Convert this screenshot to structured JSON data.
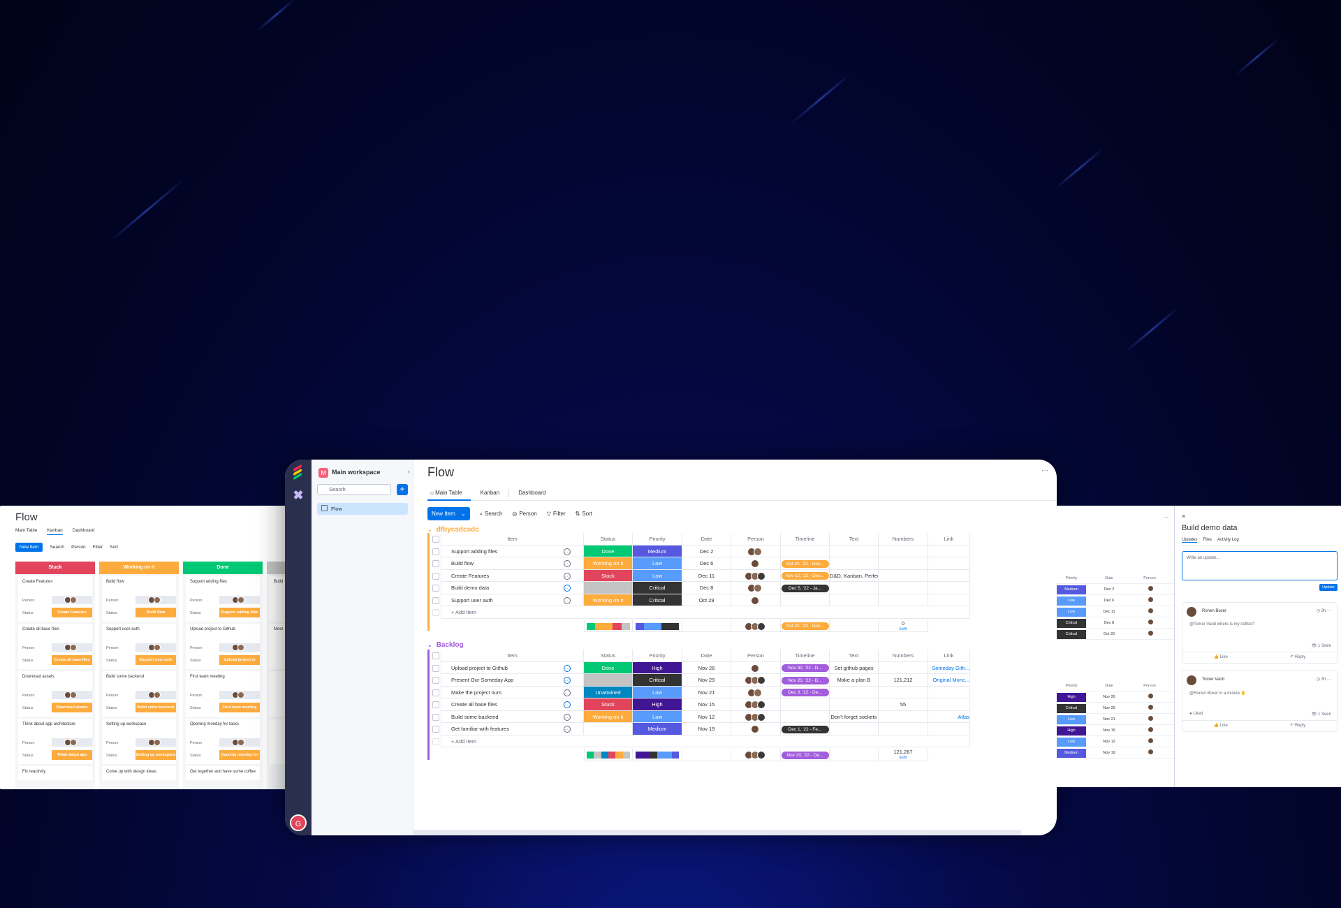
{
  "colors": {
    "blue": "#0073ea",
    "done": "#00c875",
    "working": "#fdab3d",
    "stuck": "#e2445c",
    "gray": "#c4c4c4",
    "medium": "#5559df",
    "low": "#579bfc",
    "critical": "#333333",
    "high": "#401694",
    "unattained": "#0086c0",
    "timeline_orange": "#fdab3d",
    "timeline_purple": "#a25ddc",
    "timeline_dark": "#333333"
  },
  "left": {
    "title": "Flow",
    "tabs": [
      "Main Table",
      "Kanban",
      "Dashboard"
    ],
    "tools": {
      "new_item": "New Item",
      "search": "Search",
      "person": "Person",
      "filter": "Filter",
      "sort": "Sort"
    },
    "columns": [
      {
        "name": "Stuck",
        "color": "#e2445c",
        "cards": [
          {
            "title": "Create Features",
            "status": "Create Features"
          },
          {
            "title": "Create all base files",
            "status": "Create all base files"
          },
          {
            "title": "Download assets",
            "status": "Download assets"
          },
          {
            "title": "Think about app architecture",
            "status": "Think about app architecture"
          }
        ],
        "last": "Fix reactivity"
      },
      {
        "name": "Working on it",
        "color": "#fdab3d",
        "cards": [
          {
            "title": "Build flow",
            "status": "Build flow"
          },
          {
            "title": "Support user auth",
            "status": "Support user auth"
          },
          {
            "title": "Build some backend",
            "status": "Build some backend"
          },
          {
            "title": "Setting up workspace",
            "status": "Setting up workspace"
          }
        ],
        "last": "Come up with design ideas"
      },
      {
        "name": "Done",
        "color": "#00c875",
        "cards": [
          {
            "title": "Support adding files",
            "status": "Support adding files"
          },
          {
            "title": "Upload project to Github",
            "status": "Upload project to Github"
          },
          {
            "title": "First team meeting",
            "status": "First team meeting"
          },
          {
            "title": "Opening monday for tasks",
            "status": "Opening monday for tasks"
          }
        ],
        "last": "Get together and have some coffee"
      },
      {
        "name": "",
        "color": "#c4c4c4",
        "cards": [
          {
            "title": "Build",
            "status": ""
          },
          {
            "title": "Meet",
            "status": ""
          },
          {
            "title": "",
            "status": ""
          },
          {
            "title": "",
            "status": ""
          }
        ],
        "last": ""
      }
    ],
    "labels": {
      "person": "Person",
      "status": "Status"
    }
  },
  "main": {
    "workspace": "Main workspace",
    "workspace_badge": "M",
    "search_placeholder": "Search",
    "board_item": "Flow",
    "user_initial": "G",
    "title": "Flow",
    "more": "···",
    "tabs": [
      "Main Table",
      "Kanban",
      "Dashboard"
    ],
    "tools": {
      "new_item": "New Item",
      "search": "Search",
      "person": "Person",
      "filter": "Filter",
      "sort": "Sort"
    },
    "headers": [
      "Item",
      "Status",
      "Priority",
      "Date",
      "Person",
      "Timeline",
      "Text",
      "Numbers",
      "Link"
    ],
    "add_item": "+ Add Item",
    "groups": [
      {
        "name": "dfbycsdcsdc",
        "color": "#fdab3d",
        "rows": [
          {
            "item": "Support adding files",
            "status": "Done",
            "status_color": "#00c875",
            "priority": "Medium",
            "priority_color": "#5559df",
            "date": "Dec 2",
            "avatars": 2,
            "timeline": "",
            "timeline_color": "",
            "text": "",
            "numbers": "",
            "link": ""
          },
          {
            "item": "Build flow",
            "status": "Working on it",
            "status_color": "#fdab3d",
            "priority": "Low",
            "priority_color": "#579bfc",
            "date": "Dec 6",
            "avatars": 1,
            "timeline": "Oct 30, '22 - Dec...",
            "timeline_color": "#fdab3d",
            "text": "",
            "numbers": "",
            "link": ""
          },
          {
            "item": "Create Features",
            "status": "Stuck",
            "status_color": "#e2445c",
            "priority": "Low",
            "priority_color": "#579bfc",
            "date": "Dec 11",
            "avatars": 3,
            "timeline": "Nov 12, '22 - Dec...",
            "timeline_color": "#fdab3d",
            "text": "D&D, Kanban, Perfec...",
            "numbers": "",
            "link": ""
          },
          {
            "item": "Build demo data",
            "status": "",
            "status_color": "#c4c4c4",
            "priority": "Critical",
            "priority_color": "#333333",
            "date": "Dec 8",
            "avatars": 2,
            "timeline": "Dec 5, '22 - Ja...",
            "timeline_color": "#333333",
            "text": "",
            "numbers": "",
            "link": ""
          },
          {
            "item": "Support user auth",
            "status": "Working on it",
            "status_color": "#fdab3d",
            "priority": "Critical",
            "priority_color": "#333333",
            "date": "Oct 29",
            "avatars": 1,
            "timeline": "",
            "timeline_color": "",
            "text": "",
            "numbers": "",
            "link": ""
          }
        ],
        "summary": {
          "timeline": "Oct 30, '22 - Dec...",
          "numbers": "0",
          "numbers_label": "sum"
        }
      },
      {
        "name": "Backlog",
        "color": "#a25ddc",
        "rows": [
          {
            "item": "Upload project to Github",
            "status": "Done",
            "status_color": "#00c875",
            "priority": "High",
            "priority_color": "#401694",
            "date": "Nov 26",
            "avatars": 1,
            "timeline": "Nov 30, '22 - D...",
            "timeline_color": "#a25ddc",
            "text": "Set github pages",
            "numbers": "",
            "link": "Someday Gith..."
          },
          {
            "item": "Present Our Someday App",
            "status": "",
            "status_color": "#c4c4c4",
            "priority": "Critical",
            "priority_color": "#333333",
            "date": "Nov 29",
            "avatars": 3,
            "timeline": "Nov 20, '22 - D...",
            "timeline_color": "#a25ddc",
            "text": "Make a plan B",
            "numbers": "121,212",
            "link": "Original Monc..."
          },
          {
            "item": "Make the project ours",
            "status": "Unattained",
            "status_color": "#0086c0",
            "priority": "Low",
            "priority_color": "#579bfc",
            "date": "Nov 21",
            "avatars": 2,
            "timeline": "Dec 3, '22 - De...",
            "timeline_color": "#a25ddc",
            "text": "",
            "numbers": "",
            "link": ""
          },
          {
            "item": "Create all base files",
            "status": "Stuck",
            "status_color": "#e2445c",
            "priority": "High",
            "priority_color": "#401694",
            "date": "Nov 15",
            "avatars": 3,
            "timeline": "",
            "timeline_color": "",
            "text": "",
            "numbers": "55",
            "link": ""
          },
          {
            "item": "Build some backend",
            "status": "Working on it",
            "status_color": "#fdab3d",
            "priority": "Low",
            "priority_color": "#579bfc",
            "date": "Nov 12",
            "avatars": 3,
            "timeline": "",
            "timeline_color": "",
            "text": "Don't forget sockets",
            "numbers": "",
            "link": "Atlas"
          },
          {
            "item": "Get familiar with features",
            "status": "",
            "status_color": "#ffffff",
            "priority": "Medium",
            "priority_color": "#5559df",
            "date": "Nov 19",
            "avatars": 1,
            "timeline": "Dec 1, '22 - Fe...",
            "timeline_color": "#333333",
            "text": "",
            "numbers": "",
            "link": ""
          }
        ],
        "summary": {
          "timeline": "Nov 20, '22 - De...",
          "numbers": "121,267",
          "numbers_label": "sum"
        }
      }
    ]
  },
  "right": {
    "more": "···",
    "headers": {
      "priority": "Priority",
      "date": "Date",
      "person": "Person"
    },
    "rows_top": [
      {
        "priority": "Medium",
        "color": "#5559df",
        "date": "Dec 2"
      },
      {
        "priority": "Low",
        "color": "#579bfc",
        "date": "Dec 6"
      },
      {
        "priority": "Low",
        "color": "#579bfc",
        "date": "Dec 11"
      },
      {
        "priority": "Critical",
        "color": "#333333",
        "date": "Dec 8"
      },
      {
        "priority": "Critical",
        "color": "#333333",
        "date": "Oct 29"
      }
    ],
    "rows_bottom": [
      {
        "priority": "High",
        "color": "#401694",
        "date": "Nov 26"
      },
      {
        "priority": "Critical",
        "color": "#333333",
        "date": "Nov 29"
      },
      {
        "priority": "Low",
        "color": "#579bfc",
        "date": "Nov 21"
      },
      {
        "priority": "High",
        "color": "#401694",
        "date": "Nov 15"
      },
      {
        "priority": "Low",
        "color": "#579bfc",
        "date": "Nov 12"
      },
      {
        "priority": "Medium",
        "color": "#5559df",
        "date": "Nov 19"
      }
    ],
    "panel": {
      "close": "×",
      "title": "Build demo data",
      "tabs": [
        "Updates",
        "Files",
        "Activity Log"
      ],
      "input_placeholder": "Write an update...",
      "update_btn": "Update",
      "posts": [
        {
          "name": "Ronen Boxer",
          "time": "3h",
          "body": "@Tomer Vardi where is my coffee?",
          "seen": "1 Seen",
          "like": "Like",
          "reply": "Reply"
        },
        {
          "name": "Tomer Vardi",
          "time": "3h",
          "body": "@Ronen Boxer in a minute",
          "liked": "Liked",
          "seen": "1 Seen",
          "like": "Like",
          "reply": "Reply"
        }
      ]
    }
  }
}
